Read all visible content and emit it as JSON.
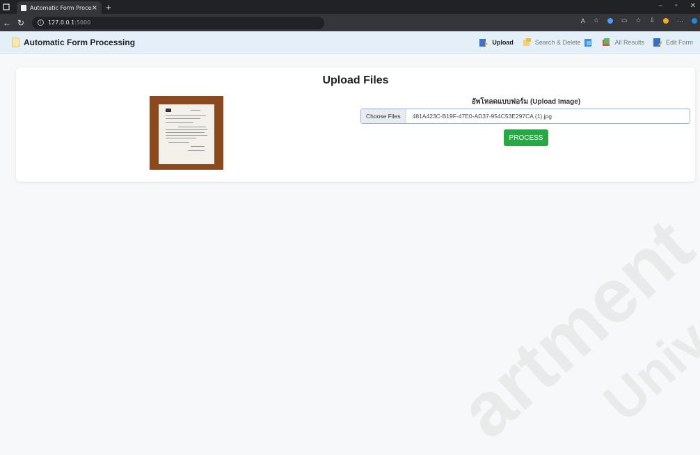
{
  "browser": {
    "tab_title": "Automatic Form Processing",
    "tab_close": "×",
    "new_tab": "+",
    "url_host": "127.0.0.1",
    "url_port": ":5000"
  },
  "app": {
    "brand": "Automatic Form Processing",
    "nav": [
      {
        "label": "Upload",
        "icon": "upload-icon"
      },
      {
        "label": "Search & Delete",
        "icon": "search-delete-icon"
      },
      {
        "label": "All Results",
        "icon": "results-icon"
      },
      {
        "label": "Edit Form",
        "icon": "edit-form-icon"
      }
    ]
  },
  "main": {
    "title": "Upload Files",
    "upload_label": "อัพโหลดแบบฟอร์ม (Upload Image)",
    "choose_button": "Choose Files",
    "file_name": "481A423C-B19F-47E0-AD37-954C53E297CA (1).jpg",
    "process_button": "PROCESS"
  },
  "watermark": {
    "line1": "artment",
    "line2": "Univers"
  },
  "colors": {
    "navbar_bg": "#e3f0f9",
    "process_button": "#28a745",
    "file_input_border": "#8ab4ff"
  }
}
